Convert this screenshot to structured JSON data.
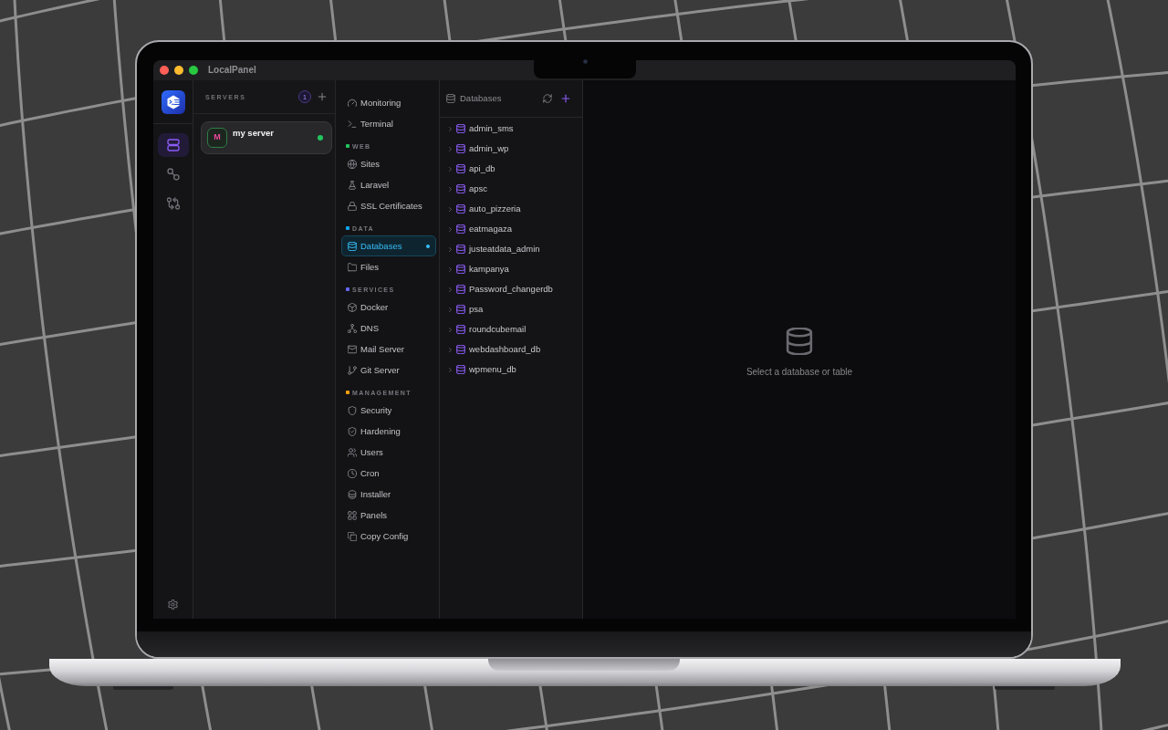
{
  "window": {
    "title": "LocalPanel"
  },
  "rail": [
    {
      "kind": "servers",
      "selected": true
    },
    {
      "kind": "links",
      "selected": false
    },
    {
      "kind": "compare",
      "selected": false
    }
  ],
  "servers": {
    "title": "SERVERS",
    "count": "1",
    "items": [
      {
        "initial": "M",
        "name": "my server",
        "selected": true,
        "online": true
      }
    ]
  },
  "nav": {
    "groups": [
      {
        "items": [
          {
            "label": "Monitoring",
            "kind": "gauge",
            "selected": false
          },
          {
            "label": "Terminal",
            "kind": "terminal",
            "selected": false
          }
        ]
      },
      {
        "title": "WEB",
        "color": "#22c55e",
        "items": [
          {
            "label": "Sites",
            "kind": "globe",
            "selected": false
          },
          {
            "label": "Laravel",
            "kind": "flask",
            "selected": false
          },
          {
            "label": "SSL Certificates",
            "kind": "lock",
            "selected": false
          }
        ]
      },
      {
        "title": "DATA",
        "color": "#0ea5e9",
        "items": [
          {
            "label": "Databases",
            "kind": "database",
            "selected": true
          },
          {
            "label": "Files",
            "kind": "folder",
            "selected": false
          }
        ]
      },
      {
        "title": "SERVICES",
        "color": "#6366f1",
        "items": [
          {
            "label": "Docker",
            "kind": "cube",
            "selected": false
          },
          {
            "label": "DNS",
            "kind": "network",
            "selected": false
          },
          {
            "label": "Mail Server",
            "kind": "mail",
            "selected": false
          },
          {
            "label": "Git Server",
            "kind": "branch",
            "selected": false
          }
        ]
      },
      {
        "title": "MANAGEMENT",
        "color": "#f59e0b",
        "items": [
          {
            "label": "Security",
            "kind": "shield",
            "selected": false
          },
          {
            "label": "Hardening",
            "kind": "shieldcheck",
            "selected": false
          },
          {
            "label": "Users",
            "kind": "users",
            "selected": false
          },
          {
            "label": "Cron",
            "kind": "clock",
            "selected": false
          },
          {
            "label": "Installer",
            "kind": "cylinder",
            "selected": false
          },
          {
            "label": "Panels",
            "kind": "grid",
            "selected": false
          },
          {
            "label": "Copy Config",
            "kind": "copy",
            "selected": false
          }
        ]
      }
    ]
  },
  "databases": {
    "title": "Databases",
    "items": [
      {
        "name": "admin_sms",
        "expanded": false
      },
      {
        "name": "admin_wp",
        "expanded": false
      },
      {
        "name": "api_db",
        "expanded": false
      },
      {
        "name": "apsc",
        "expanded": false
      },
      {
        "name": "auto_pizzeria",
        "expanded": false
      },
      {
        "name": "eatmagaza",
        "expanded": false
      },
      {
        "name": "justeatdata_admin",
        "expanded": false
      },
      {
        "name": "kampanya",
        "expanded": false
      },
      {
        "name": "Password_changerdb",
        "expanded": false
      },
      {
        "name": "psa",
        "expanded": false
      },
      {
        "name": "roundcubemail",
        "expanded": false
      },
      {
        "name": "webdashboard_db",
        "expanded": false
      },
      {
        "name": "wpmenu_db",
        "expanded": false
      }
    ]
  },
  "main": {
    "message": "Select a database or table"
  }
}
